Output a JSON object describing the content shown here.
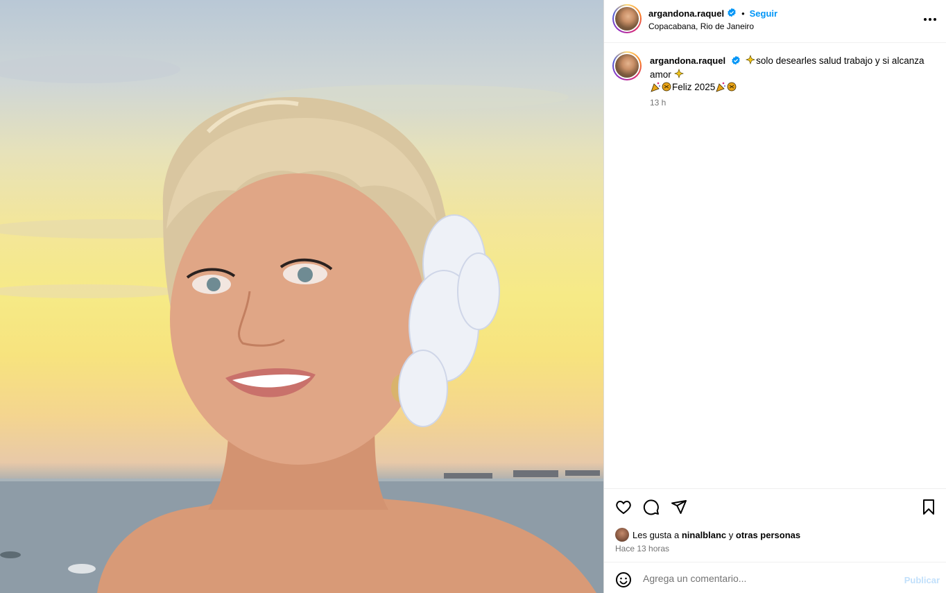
{
  "post": {
    "username": "argandona.raquel",
    "follow_label": "Seguir",
    "separator": "•",
    "location": "Copacabana, Rio de Janeiro",
    "caption_line1": "solo desearles salud trabajo y si alcanza amor",
    "caption_line2": "Feliz 2025",
    "time_ago": "13 h"
  },
  "likes": {
    "prefix": "Les gusta a",
    "user": "ninalblanc",
    "connector": "y",
    "others": "otras personas",
    "time_full": "Hace 13 horas"
  },
  "comment": {
    "placeholder": "Agrega un comentario...",
    "publish_label": "Publicar"
  },
  "colors": {
    "accent": "#0095f6",
    "publish_disabled": "#c2e0fb",
    "muted": "#737373"
  },
  "icons": [
    "verified-badge-icon",
    "more-options-icon",
    "sparkle-emoji-icon",
    "party-popper-emoji-icon",
    "heart-icon",
    "comment-icon",
    "share-icon",
    "bookmark-icon",
    "emoji-icon"
  ]
}
